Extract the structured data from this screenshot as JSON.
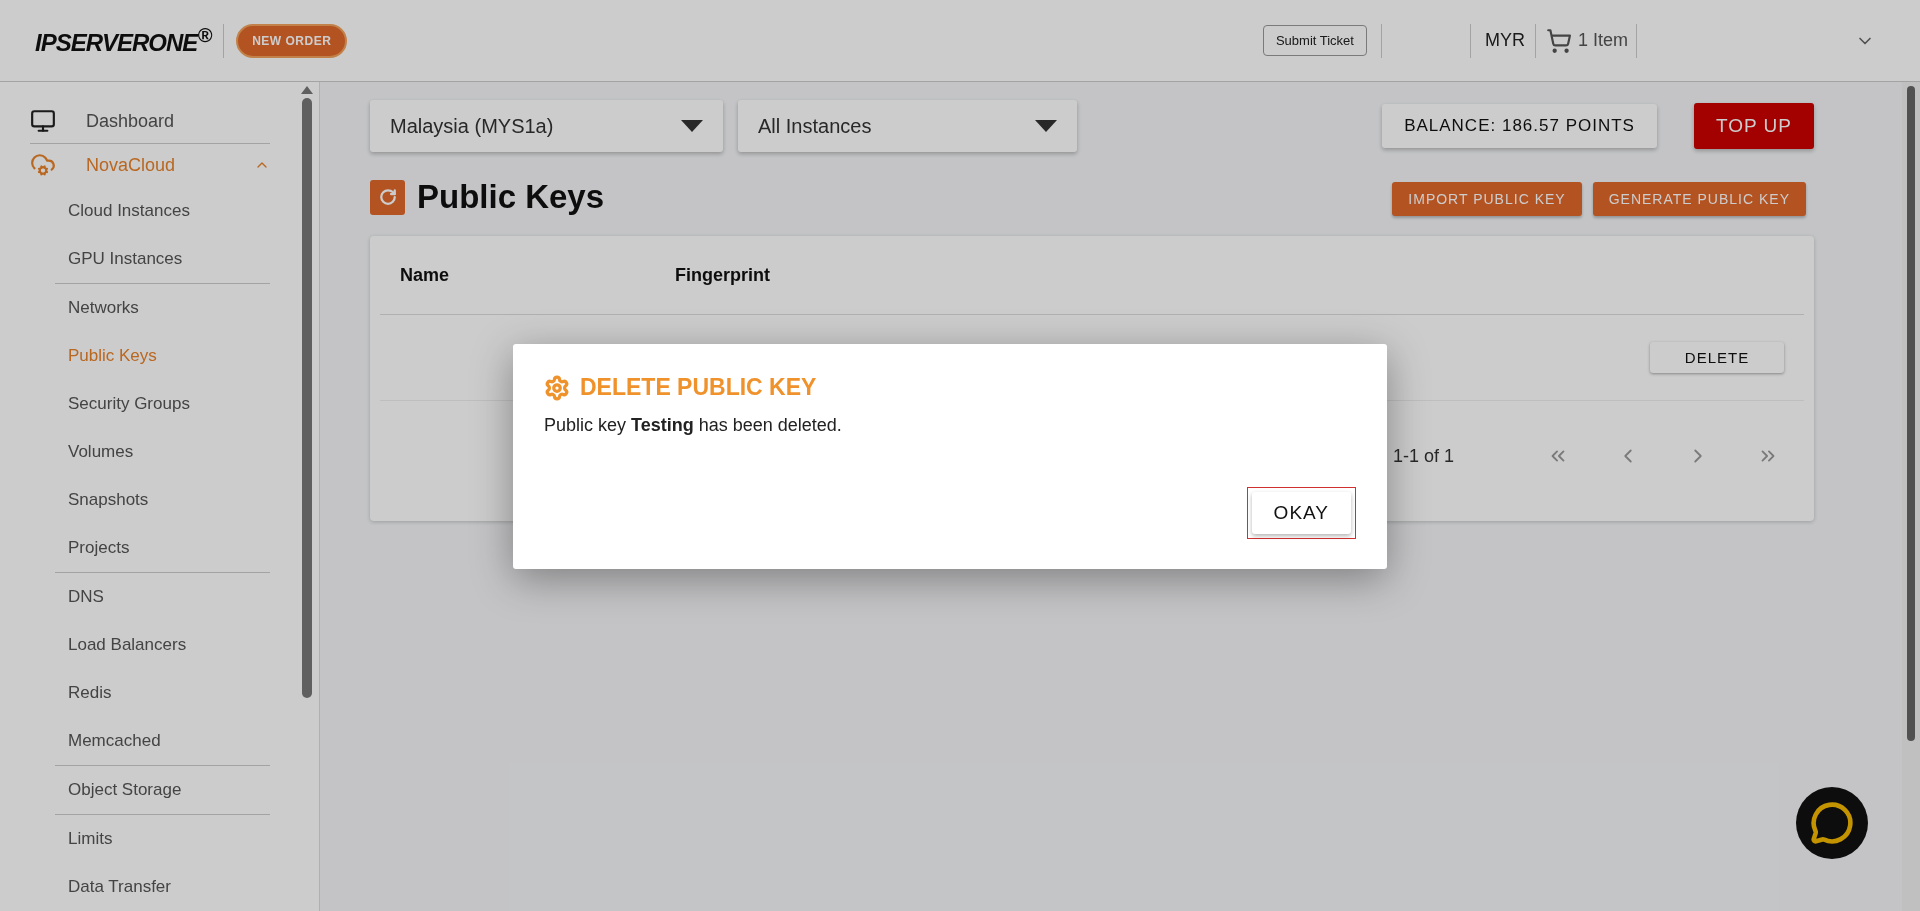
{
  "header": {
    "logo": "IPSERVERONE",
    "logo_mark": "®",
    "new_order": "NEW ORDER",
    "submit_ticket": "Submit Ticket",
    "currency": "MYR",
    "cart": "1 Item"
  },
  "sidebar": {
    "items": [
      {
        "label": "Dashboard",
        "selected": false
      },
      {
        "label": "NovaCloud",
        "selected": true,
        "expanded": true,
        "groups": [
          {
            "children": [
              {
                "label": "Cloud Instances",
                "selected": false
              },
              {
                "label": "GPU Instances",
                "selected": false
              }
            ]
          },
          {
            "children": [
              {
                "label": "Networks",
                "selected": false
              },
              {
                "label": "Public Keys",
                "selected": true
              },
              {
                "label": "Security Groups",
                "selected": false
              },
              {
                "label": "Volumes",
                "selected": false
              },
              {
                "label": "Snapshots",
                "selected": false
              },
              {
                "label": "Projects",
                "selected": false
              }
            ]
          },
          {
            "children": [
              {
                "label": "DNS",
                "selected": false
              },
              {
                "label": "Load Balancers",
                "selected": false
              },
              {
                "label": "Redis",
                "selected": false
              },
              {
                "label": "Memcached",
                "selected": false
              }
            ]
          },
          {
            "children": [
              {
                "label": "Object Storage",
                "selected": false
              }
            ]
          },
          {
            "children": [
              {
                "label": "Limits",
                "selected": false
              },
              {
                "label": "Data Transfer",
                "selected": false
              }
            ]
          }
        ]
      }
    ]
  },
  "filters": [
    {
      "value": "Malaysia (MYS1a)"
    },
    {
      "value": "All Instances"
    }
  ],
  "balance": "BALANCE: 186.57 POINTS",
  "top_up": "TOP UP",
  "page_title": "Public Keys",
  "actions": [
    "IMPORT PUBLIC KEY",
    "GENERATE PUBLIC KEY"
  ],
  "table": {
    "columns": [
      "Name",
      "Fingerprint"
    ],
    "row_action": "DELETE",
    "pagination": "1-1 of 1"
  },
  "dialog": {
    "title": "DELETE PUBLIC KEY",
    "message": "Public key **Testing** has been deleted.",
    "ok": {
      "label": "OKAY",
      "focused": true
    }
  }
}
